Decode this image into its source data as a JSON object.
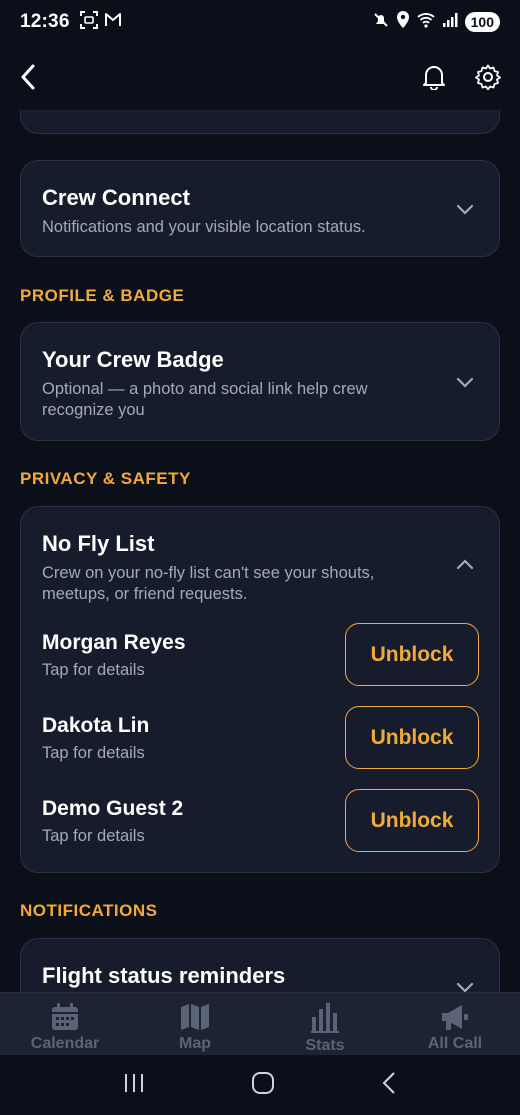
{
  "status_bar": {
    "time": "12:36",
    "battery": "100",
    "icons": [
      "screenshot-icon",
      "gmail-icon",
      "mute-icon",
      "location-icon",
      "wifi-icon",
      "signal-icon"
    ]
  },
  "header": {
    "back_icon": "back-arrow-icon",
    "right_icons": [
      "bell-icon",
      "gear-icon"
    ]
  },
  "sections": {
    "crew_connect": {
      "title": "Crew Connect",
      "subtitle": "Notifications and your visible location status."
    },
    "profile_label": "PROFILE & BADGE",
    "crew_badge": {
      "title": "Your Crew Badge",
      "subtitle": "Optional — a photo and social link help crew recognize you"
    },
    "privacy_label": "PRIVACY & SAFETY",
    "no_fly": {
      "title": "No Fly List",
      "subtitle": "Crew on your no-fly list can't see your shouts, meetups, or friend requests.",
      "entries": [
        {
          "name": "Morgan Reyes",
          "sub": "Tap for details",
          "action": "Unblock"
        },
        {
          "name": "Dakota Lin",
          "sub": "Tap for details",
          "action": "Unblock"
        },
        {
          "name": "Demo Guest 2",
          "sub": "Tap for details",
          "action": "Unblock"
        }
      ]
    },
    "notifications_label": "NOTIFICATIONS",
    "flight_status": {
      "title": "Flight status reminders"
    }
  },
  "tabbar": {
    "tabs": [
      {
        "label": "Calendar",
        "icon": "calendar-icon"
      },
      {
        "label": "Map",
        "icon": "map-icon"
      },
      {
        "label": "Stats",
        "icon": "stats-icon"
      },
      {
        "label": "All Call",
        "icon": "megaphone-icon"
      }
    ]
  },
  "colors": {
    "accent": "#f2a93b",
    "background": "#0b0f1a",
    "card": "#161c2b"
  }
}
